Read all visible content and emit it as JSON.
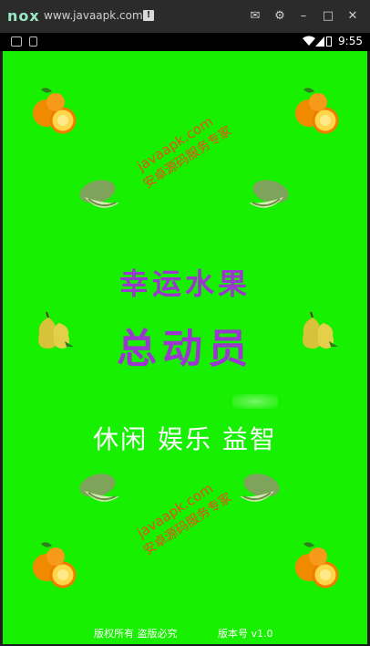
{
  "titlebar": {
    "logo": "nox",
    "url": "www.javaapk.com",
    "info_icon": "!",
    "buttons": [
      {
        "name": "mail-icon",
        "glyph": "✉"
      },
      {
        "name": "gear-icon",
        "glyph": "⚙"
      },
      {
        "name": "minimize-icon",
        "glyph": "–"
      },
      {
        "name": "maximize-icon",
        "glyph": "□"
      },
      {
        "name": "close-icon",
        "glyph": "✕"
      }
    ]
  },
  "statusbar": {
    "time": "9:55"
  },
  "app": {
    "title_line1": "幸运水果",
    "title_line2": "总动员",
    "tagline": "休闲 娱乐 益智",
    "watermark_1": "javaapk.com",
    "watermark_2": "安卓源码服务专家",
    "footer_left": "版权所有 盗版必究",
    "footer_right": "版本号 v1.0"
  },
  "colors": {
    "background": "#17f000",
    "title": "#9b37cf",
    "watermark": "#ff3b1f"
  }
}
